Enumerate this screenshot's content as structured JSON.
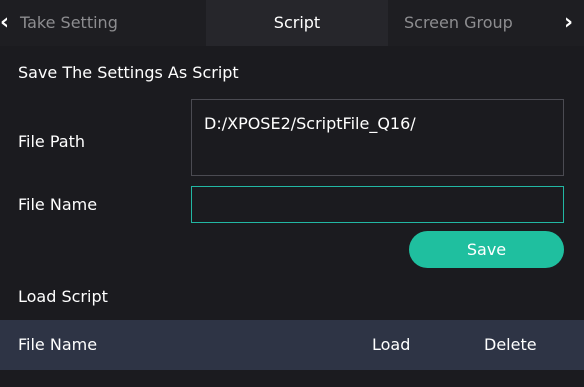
{
  "tabs": {
    "take_setting": "Take Setting",
    "script": "Script",
    "screen_group": "Screen Group"
  },
  "save_section": {
    "title": "Save The Settings As Script",
    "file_path_label": "File Path",
    "file_path_value": "D:/XPOSE2/ScriptFile_Q16/",
    "file_name_label": "File Name",
    "file_name_value": "",
    "save_button": "Save"
  },
  "load_section": {
    "title": "Load Script",
    "columns": [
      "File Name",
      "Load",
      "Delete"
    ]
  },
  "colors": {
    "accent": "#1fbf9f",
    "input_border": "#22b7a3",
    "table_header_bg": "#2e3445",
    "background": "#1b1b1f"
  }
}
